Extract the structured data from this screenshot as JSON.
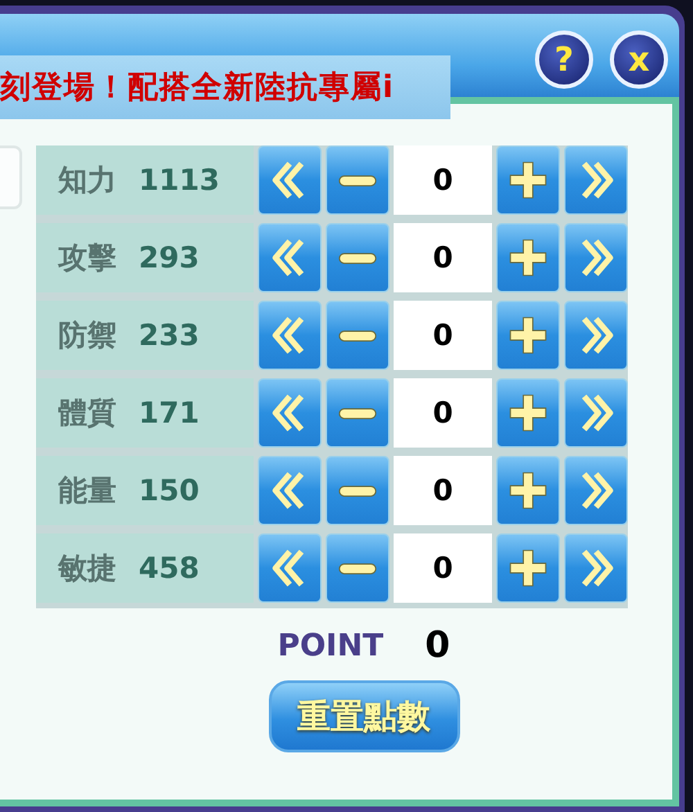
{
  "ticker": "刻登場！配搭全新陸抗專屬i",
  "help_button": "?",
  "close_button": "x",
  "stats": [
    {
      "name": "知力",
      "value": "1113",
      "allocated": "0"
    },
    {
      "name": "攻擊",
      "value": "293",
      "allocated": "0"
    },
    {
      "name": "防禦",
      "value": "233",
      "allocated": "0"
    },
    {
      "name": "體質",
      "value": "171",
      "allocated": "0"
    },
    {
      "name": "能量",
      "value": "150",
      "allocated": "0"
    },
    {
      "name": "敏捷",
      "value": "458",
      "allocated": "0"
    }
  ],
  "point_label": "POINT",
  "point_value": "0",
  "reset_button": "重置點數"
}
